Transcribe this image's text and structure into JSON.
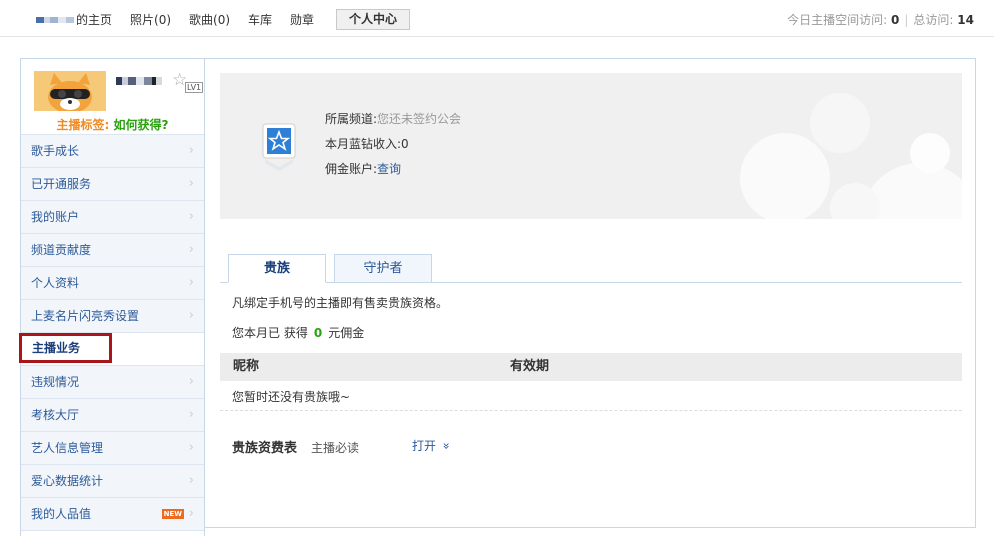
{
  "nav": {
    "home": "的主页",
    "photos": "照片(0)",
    "songs": "歌曲(0)",
    "garage": "车库",
    "medals": "勋章",
    "personal_center": "个人中心"
  },
  "visits": {
    "today_label": "今日主播空间访问:",
    "today_value": "0",
    "total_label": "总访问:",
    "total_value": "14"
  },
  "profile": {
    "level_badge": "LV1",
    "tag_label": "主播标签:",
    "tag_link": "如何获得?"
  },
  "sidebar": {
    "items": [
      {
        "label": "歌手成长"
      },
      {
        "label": "已开通服务"
      },
      {
        "label": "我的账户"
      },
      {
        "label": "频道贡献度"
      },
      {
        "label": "个人资料"
      },
      {
        "label": "上麦名片闪亮秀设置"
      },
      {
        "label": "主播业务"
      },
      {
        "label": "违规情况"
      },
      {
        "label": "考核大厅"
      },
      {
        "label": "艺人信息管理"
      },
      {
        "label": "爱心数据统计"
      },
      {
        "label": "我的人品值"
      }
    ],
    "new_badge": "NEW"
  },
  "info": {
    "channel_label": "所属频道:",
    "channel_value": "您还未签约公会",
    "income_label": "本月蓝钻收入:",
    "income_value": "0",
    "commission_label": "佣金账户:",
    "commission_link": "查询"
  },
  "tabs": [
    {
      "label": "贵族"
    },
    {
      "label": "守护者"
    }
  ],
  "noble": {
    "notice": "凡绑定手机号的主播即有售卖贵族资格。",
    "earn_prefix": "您本月已 获得",
    "earn_value": "0",
    "earn_suffix": "元佣金",
    "col_nick": "昵称",
    "col_valid": "有效期",
    "empty": "您暂时还没有贵族哦~",
    "fee_title": "贵族资费表",
    "fee_sub": "主播必读",
    "fee_open": "打开"
  },
  "colors": {
    "link": "#2d5a99",
    "green": "#2aa10f",
    "orange": "#f08a24",
    "active_border": "#a8161b"
  }
}
